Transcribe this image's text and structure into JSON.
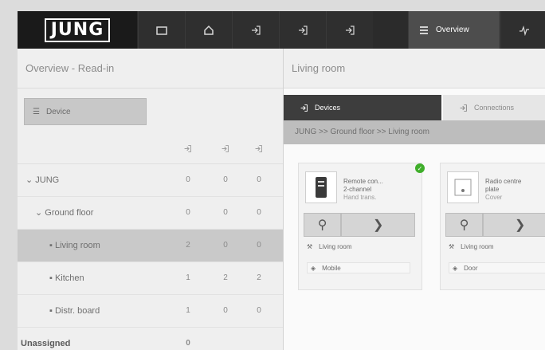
{
  "brand": {
    "logo_text": "JUNG"
  },
  "topnav": {
    "items": [
      {
        "icon": "folder-icon"
      },
      {
        "icon": "home-icon"
      },
      {
        "icon": "login-icon"
      },
      {
        "icon": "login-icon"
      },
      {
        "icon": "login-icon"
      },
      {
        "icon": "list-icon",
        "label": "Overview",
        "active": true
      },
      {
        "icon": "pulse-icon"
      }
    ]
  },
  "left": {
    "title": "Overview - Read-in",
    "device_button": "Device",
    "tree": [
      {
        "name": "JUNG",
        "level": 0,
        "expanded": true,
        "counts": [
          "0",
          "0",
          "0"
        ]
      },
      {
        "name": "Ground floor",
        "level": 1,
        "expanded": true,
        "counts": [
          "0",
          "0",
          "0"
        ]
      },
      {
        "name": "Living room",
        "level": 2,
        "selected": true,
        "counts": [
          "2",
          "0",
          "0"
        ]
      },
      {
        "name": "Kitchen",
        "level": 2,
        "counts": [
          "1",
          "2",
          "2"
        ]
      },
      {
        "name": "Distr. board",
        "level": 2,
        "counts": [
          "1",
          "0",
          "0"
        ]
      },
      {
        "name": "Unassigned",
        "level": -1,
        "counts": [
          "0"
        ]
      }
    ]
  },
  "right": {
    "title": "Living room",
    "tabs": {
      "devices": "Devices",
      "connections": "Connections"
    },
    "breadcrumb": "JUNG >> Ground floor >> Living room",
    "cards": [
      {
        "title1": "Remote con...",
        "title2": "2-channel",
        "subtitle": "Hand trans.",
        "location": "Living room",
        "tag": "Mobile",
        "status": "ok"
      },
      {
        "title1": "Radio centre",
        "title2": "plate",
        "subtitle": "Cover",
        "location": "Living room",
        "tag": "Door"
      }
    ]
  },
  "colors": {
    "topbar": "#2b2b2b",
    "active_nav": "#4d4d4d",
    "selected_row": "#c9c9c9",
    "status_ok": "#3fae2a"
  }
}
